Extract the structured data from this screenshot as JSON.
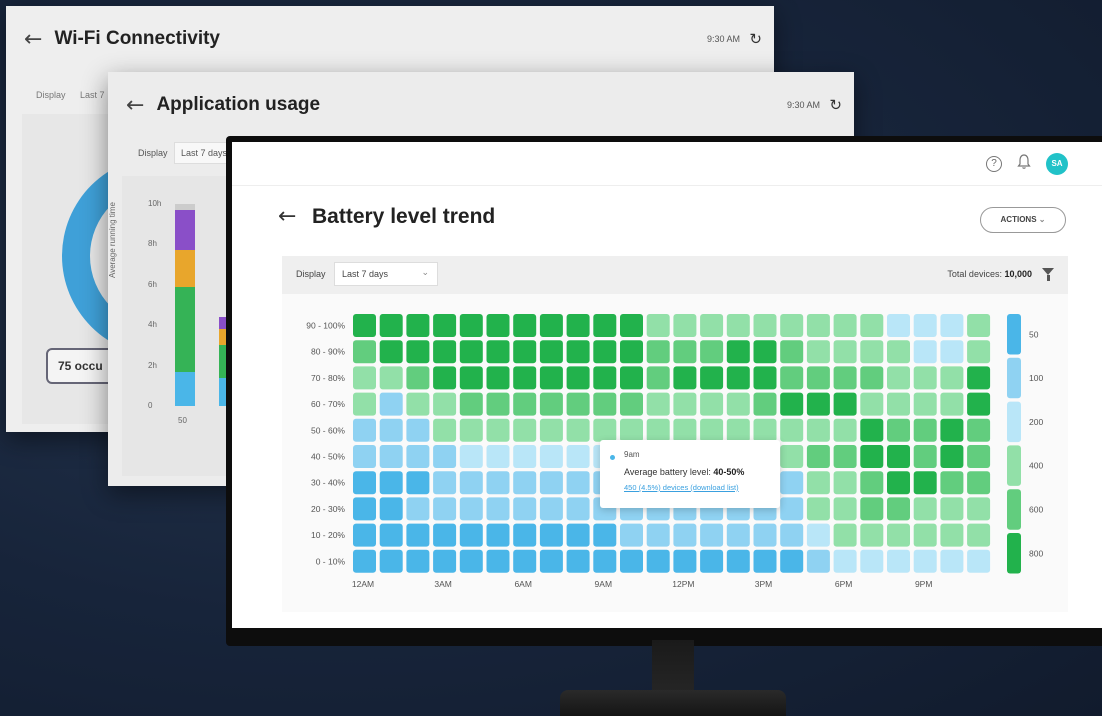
{
  "window_wifi": {
    "title": "Wi-Fi Connectivity",
    "time": "9:30 AM",
    "display_label": "Display",
    "range_label": "Last 7",
    "occurrences_text": "75 occu",
    "donut_colors": [
      "#7b4cc4",
      "#3fa0d8"
    ]
  },
  "window_app": {
    "title": "Application usage",
    "time": "9:30 AM",
    "display_label": "Display",
    "range_label": "Last 7 days",
    "y_axis_title": "Average running time",
    "y_ticks": [
      "10h",
      "8h",
      "6h",
      "4h",
      "2h",
      "0"
    ],
    "x_first_label": "50",
    "bars": [
      {
        "segments": [
          {
            "value": 1.7,
            "color": "#4ab6e8"
          },
          {
            "value": 4.2,
            "color": "#35b356"
          },
          {
            "value": 1.8,
            "color": "#e8a62c"
          },
          {
            "value": 2.0,
            "color": "#8a4fc8"
          },
          {
            "value": 0.3,
            "color": "#cccccc"
          }
        ]
      },
      {
        "segments": [
          {
            "value": 1.4,
            "color": "#4ab6e8"
          },
          {
            "value": 1.6,
            "color": "#35b356"
          },
          {
            "value": 0.8,
            "color": "#e8a62c"
          },
          {
            "value": 0.6,
            "color": "#8a4fc8"
          }
        ]
      }
    ]
  },
  "main": {
    "title": "Battery level trend",
    "actions_label": "ACTIONS",
    "display_label": "Display",
    "range_label": "Last 7 days",
    "total_label": "Total devices:",
    "total_value": "10,000",
    "avatar_initials": "SA",
    "icons": [
      "help-icon",
      "bell-icon",
      "filter-icon",
      "back-arrow-icon",
      "chevron-down-icon"
    ]
  },
  "tooltip": {
    "time": "9am",
    "avg_label": "Average battery level:",
    "avg_value": "40-50%",
    "link": "450 (4.5%) devices (download list)"
  },
  "chart_data": {
    "type": "heatmap",
    "title": "Battery level trend",
    "y_categories": [
      "90 - 100%",
      "80 - 90%",
      "70 - 80%",
      "60 - 70%",
      "50 - 60%",
      "40 - 50%",
      "30 - 40%",
      "20 - 30%",
      "10 - 20%",
      "0 - 10%"
    ],
    "x_tick_labels": [
      "12AM",
      "3AM",
      "6AM",
      "9AM",
      "12PM",
      "3PM",
      "6PM",
      "9PM"
    ],
    "x_tick_every": 3,
    "columns": 24,
    "color_scale": [
      {
        "label": "50",
        "color": "#4ab6e8"
      },
      {
        "label": "100",
        "color": "#8fd2f2"
      },
      {
        "label": "200",
        "color": "#b9e6f8"
      },
      {
        "label": "400",
        "color": "#92e0a8"
      },
      {
        "label": "600",
        "color": "#62cd7e"
      },
      {
        "label": "800",
        "color": "#22b24c"
      }
    ],
    "values": [
      [
        5,
        5,
        5,
        5,
        5,
        5,
        5,
        5,
        5,
        5,
        5,
        3,
        3,
        3,
        3,
        3,
        3,
        3,
        3,
        3,
        2,
        2,
        2,
        3
      ],
      [
        4,
        5,
        5,
        5,
        5,
        5,
        5,
        5,
        5,
        5,
        5,
        4,
        4,
        4,
        5,
        5,
        4,
        3,
        3,
        3,
        3,
        2,
        2,
        3
      ],
      [
        3,
        3,
        4,
        5,
        5,
        5,
        5,
        5,
        5,
        5,
        5,
        4,
        5,
        5,
        5,
        5,
        4,
        4,
        4,
        4,
        3,
        3,
        3,
        5
      ],
      [
        3,
        1,
        3,
        3,
        4,
        4,
        4,
        4,
        4,
        4,
        4,
        3,
        3,
        3,
        3,
        4,
        5,
        5,
        5,
        3,
        3,
        3,
        3,
        5
      ],
      [
        1,
        1,
        1,
        3,
        3,
        3,
        3,
        3,
        3,
        3,
        3,
        3,
        3,
        3,
        3,
        3,
        3,
        3,
        3,
        5,
        4,
        4,
        5,
        4
      ],
      [
        1,
        1,
        1,
        1,
        2,
        2,
        2,
        2,
        2,
        2,
        2,
        2,
        2,
        2,
        2,
        2,
        3,
        4,
        4,
        5,
        5,
        4,
        5,
        4
      ],
      [
        0,
        0,
        0,
        1,
        1,
        1,
        1,
        1,
        1,
        1,
        1,
        2,
        2,
        2,
        2,
        2,
        1,
        3,
        3,
        4,
        5,
        5,
        4,
        4
      ],
      [
        0,
        0,
        1,
        1,
        1,
        1,
        1,
        1,
        1,
        1,
        1,
        1,
        1,
        1,
        1,
        1,
        1,
        3,
        3,
        4,
        4,
        3,
        3,
        3
      ],
      [
        0,
        0,
        0,
        0,
        0,
        0,
        0,
        0,
        0,
        0,
        1,
        1,
        1,
        1,
        1,
        1,
        1,
        2,
        3,
        3,
        3,
        3,
        3,
        3
      ],
      [
        0,
        0,
        0,
        0,
        0,
        0,
        0,
        0,
        0,
        0,
        0,
        0,
        0,
        0,
        0,
        0,
        0,
        1,
        2,
        2,
        2,
        2,
        2,
        2
      ]
    ]
  }
}
